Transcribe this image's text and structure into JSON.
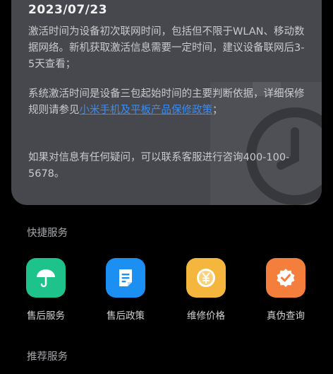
{
  "info_card": {
    "date": "2023/07/23",
    "para1": "激活时间为设备初次联网时间，包括但不限于WLAN、移动数据网络。新机获取激活信息需要一定时间，建议设备联网后3-5天查看；",
    "para2_prefix": "系统激活时间是设备三包起始时间的主要判断依据，详细保修规则请参见",
    "para2_link": "小米手机及平板产品保修政策",
    "para2_suffix": "；",
    "para3": "如果对信息有任何疑问，可以联系客服进行咨询400-100-5678。"
  },
  "quick_services": {
    "title": "快捷服务",
    "items": [
      {
        "label": "售后服务",
        "icon": "umbrella-icon",
        "color": "#1ec28b"
      },
      {
        "label": "售后政策",
        "icon": "document-icon",
        "color": "#1b8ff2"
      },
      {
        "label": "维修价格",
        "icon": "yuan-coin-icon",
        "color": "#f4b63d"
      },
      {
        "label": "真伪查询",
        "icon": "verified-badge-icon",
        "color": "#f47f3d"
      }
    ]
  },
  "recommended_services": {
    "title": "推荐服务"
  }
}
